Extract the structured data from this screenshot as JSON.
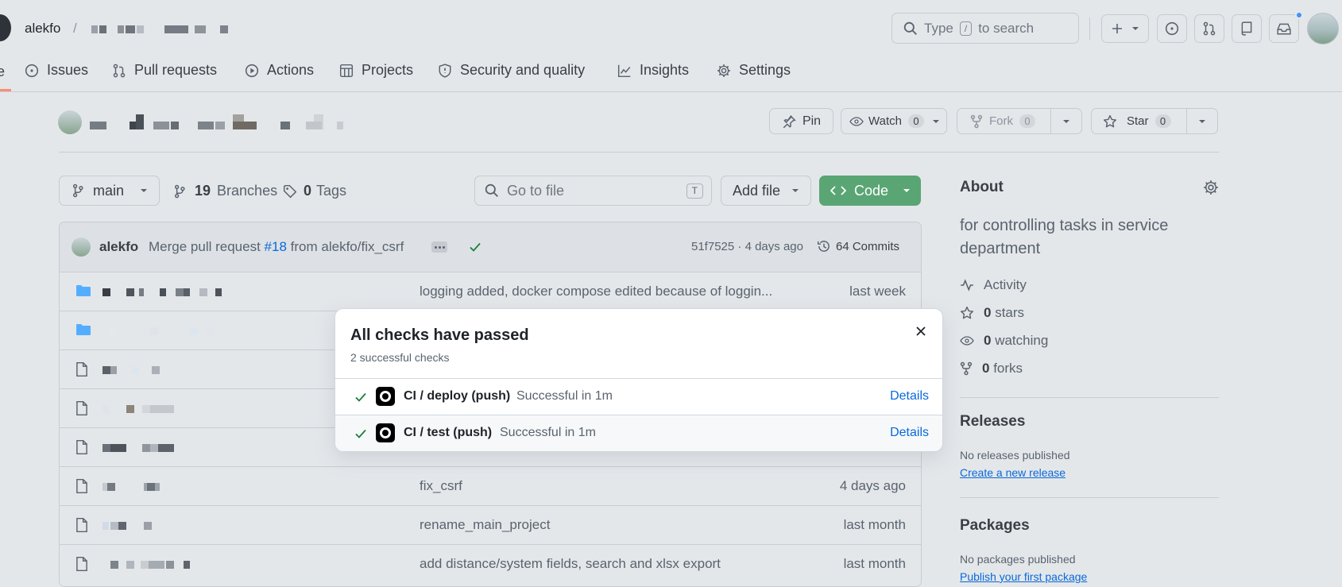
{
  "header": {
    "owner": "alekfo",
    "separator": "/",
    "search_placeholder_pre": "Type",
    "search_key": "/",
    "search_placeholder_post": "to search"
  },
  "tabs": [
    {
      "label": "Issues",
      "icon": "issue-icon"
    },
    {
      "label": "Pull requests",
      "icon": "pull-request-icon"
    },
    {
      "label": "Actions",
      "icon": "actions-icon"
    },
    {
      "label": "Projects",
      "icon": "projects-icon"
    },
    {
      "label": "Security and quality",
      "icon": "shield-icon"
    },
    {
      "label": "Insights",
      "icon": "insights-icon"
    },
    {
      "label": "Settings",
      "icon": "gear-icon"
    }
  ],
  "repo_actions": {
    "pin": "Pin",
    "watch": "Watch",
    "watch_count": "0",
    "fork": "Fork",
    "fork_count": "0",
    "star": "Star",
    "star_count": "0"
  },
  "toolbar": {
    "branch": "main",
    "branches_count": "19",
    "branches_label": "Branches",
    "tags_count": "0",
    "tags_label": "Tags",
    "goto_placeholder": "Go to file",
    "goto_key": "T",
    "add_file": "Add file",
    "code": "Code"
  },
  "commit": {
    "author": "alekfo",
    "message_pre": "Merge pull request",
    "pr": "#18",
    "message_post": "from alekfo/fix_csrf",
    "sha": "51f7525",
    "dot": "·",
    "time": "4 days ago",
    "commits": "64 Commits"
  },
  "files": [
    {
      "type": "folder",
      "message": "logging added, docker compose edited because of loggin...",
      "time": "last week"
    },
    {
      "type": "folder",
      "message": "",
      "time": ""
    },
    {
      "type": "file",
      "message": "",
      "time": ""
    },
    {
      "type": "file",
      "message": "",
      "time": ""
    },
    {
      "type": "file",
      "message": "",
      "time": ""
    },
    {
      "type": "file",
      "message": "fix_csrf",
      "time": "4 days ago"
    },
    {
      "type": "file",
      "message": "rename_main_project",
      "time": "last month"
    },
    {
      "type": "file",
      "message": "add distance/system fields, search and xlsx export",
      "time": "last month"
    }
  ],
  "popover": {
    "title": "All checks have passed",
    "subtitle": "2 successful checks",
    "checks": [
      {
        "name": "CI / deploy (push)",
        "status": "Successful in 1m",
        "link": "Details"
      },
      {
        "name": "CI / test (push)",
        "status": "Successful in 1m",
        "link": "Details"
      }
    ]
  },
  "about": {
    "title": "About",
    "description": "for controlling tasks in service department",
    "activity": "Activity",
    "stars_count": "0",
    "stars_label": "stars",
    "watching_count": "0",
    "watching_label": "watching",
    "forks_count": "0",
    "forks_label": "forks",
    "releases_title": "Releases",
    "releases_none": "No releases published",
    "releases_link": "Create a new release",
    "packages_title": "Packages",
    "packages_none": "No packages published",
    "packages_link": "Publish your first package"
  },
  "colors": {
    "accent": "#0969da",
    "success": "#1a7f37",
    "code_button": "#5aa574",
    "notification": "#4493f8"
  }
}
